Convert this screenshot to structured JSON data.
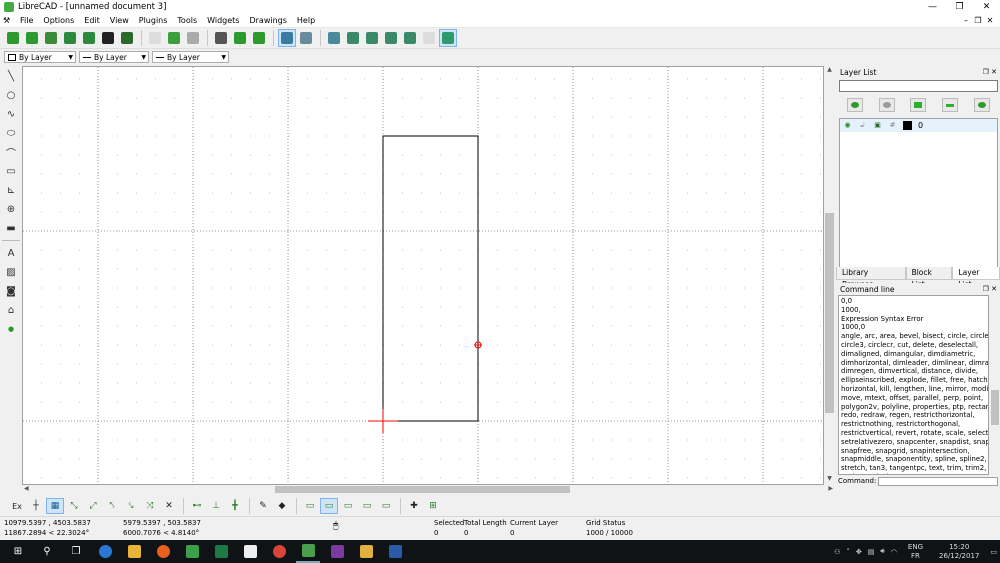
{
  "window": {
    "title": "LibreCAD - [unnamed document 3]",
    "buttons": [
      "—",
      "❐",
      "✕"
    ]
  },
  "menu": {
    "items": [
      "File",
      "Options",
      "Edit",
      "View",
      "Plugins",
      "Tools",
      "Widgets",
      "Drawings",
      "Help"
    ],
    "mdi_buttons": [
      "–",
      "❐",
      "✕"
    ]
  },
  "layerbar": {
    "color": "By Layer",
    "linewidth": "By Layer",
    "linetype": "By Layer"
  },
  "layer_panel": {
    "title": "Layer List",
    "layers": [
      {
        "name": "0"
      }
    ]
  },
  "tabs": [
    "Library Browser",
    "Block List",
    "Layer List"
  ],
  "command_panel": {
    "title": "Command line",
    "history": [
      "0,0",
      "1000,",
      "Expression Syntax Error",
      "1000,0",
      "angle, arc, area, bevel, bisect, circle, circle2,",
      "circle3, circlecr, cut, delete, deselectall,",
      "dimaligned, dimangular, dimdiametric,",
      "dimhorizontal, dimleader, dimlinear, dimradial,",
      "dimregen, dimvertical, distance, divide,",
      "ellipseinscribed, explode, fillet, free, hatch,",
      "horizontal, kill, lengthen, line, mirror, modifyattr,",
      "move, mtext, offset, parallel, perp, point,",
      "polygon2v, polyline, properties, ptp, rectangle,",
      "redo, redraw, regen, restricthorizontal,",
      "restrictnothing, restrictorthogonal,",
      "restrictvertical, revert, rotate, scale, selectall,",
      "setrelativezero, snapcenter, snapdist, snapend,",
      "snapfree, snapgrid, snapintersection,",
      "snapmiddle, snaponentity, spline, spline2,",
      "stretch, tan3, tangentpc, text, trim, trim2,",
      "undo, vertical, zoomauto, zoompan,",
      "zoomprevious, zoomwindow"
    ],
    "input_label": "Command:"
  },
  "snapbar": {
    "ex_label": "Ex"
  },
  "status": {
    "abs_coord": "10979.5397 , 4503.5837",
    "abs_polar": "11867.2894 < 22.3024°",
    "rel_coord": "5979.5397 , 503.5837",
    "rel_polar": "6000.7076 < 4.8140°",
    "selected_label": "Selected",
    "selected_value": "0",
    "total_length_label": "Total Length",
    "total_length_value": "0",
    "current_layer_label": "Current Layer",
    "current_layer_value": "0",
    "grid_status_label": "Grid Status",
    "grid_status_value": "1000 / 10000"
  },
  "taskbar": {
    "lang_top": "ENG",
    "lang_bottom": "FR",
    "time": "15:20",
    "date": "26/12/2017"
  },
  "colors": {
    "canvas_bg": "#ffffff",
    "grid_dot": "#c0c0c0",
    "meta_grid": "#7a7a7a",
    "entity": "#000000",
    "cursor_red": "#ff0000",
    "accent_green": "#2a9a2a",
    "taskbar": "#101316"
  }
}
